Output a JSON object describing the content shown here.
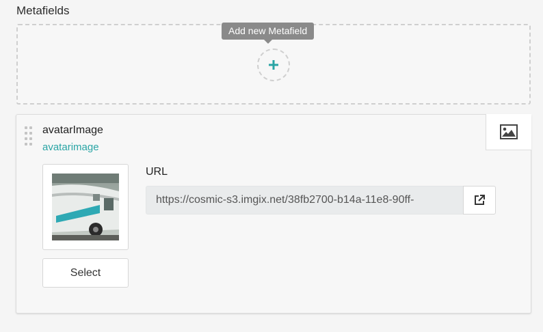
{
  "section": {
    "title": "Metafields"
  },
  "add_metafield": {
    "tooltip": "Add new Metafield",
    "icon": "plus-icon",
    "accent": "#2aa5a5"
  },
  "metafield": {
    "title": "avatarImage",
    "key": "avatarimage",
    "type_icon": "image-icon",
    "drag_icon": "drag-handle-icon",
    "thumbnail_alt": "avatarImage thumbnail",
    "select_label": "Select",
    "url_label": "URL",
    "url_value": "https://cosmic-s3.imgix.net/38fb2700-b14a-11e8-90ff-",
    "open_icon": "external-link-icon"
  },
  "colors": {
    "accent": "#2aa5a5",
    "tooltip_bg": "#8a8a8a"
  }
}
